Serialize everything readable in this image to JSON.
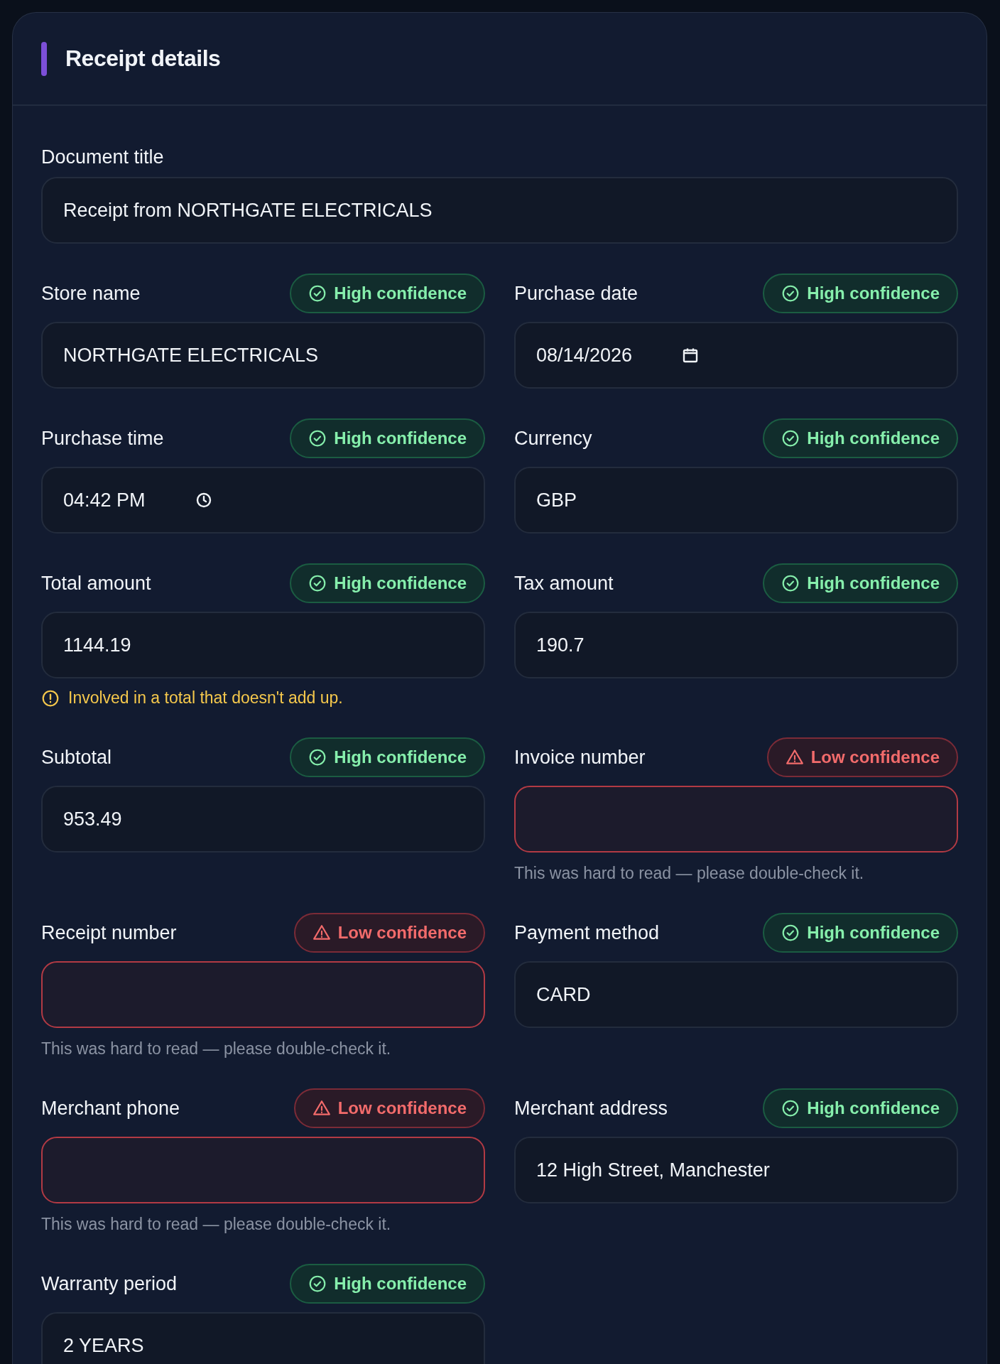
{
  "card": {
    "title": "Receipt details"
  },
  "document_title": {
    "label": "Document title",
    "value": "Receipt from NORTHGATE ELECTRICALS"
  },
  "fields": [
    {
      "label": "Store name",
      "kind": "text",
      "value": "NORTHGATE ELECTRICALS",
      "low_confidence": false,
      "badge": "High confidence"
    },
    {
      "label": "Purchase date",
      "kind": "date",
      "value": "08/14/2026",
      "low_confidence": false,
      "badge": "High confidence"
    },
    {
      "label": "Purchase time",
      "kind": "time",
      "value": "04:42 PM",
      "low_confidence": false,
      "badge": "High confidence"
    },
    {
      "label": "Currency",
      "kind": "text",
      "value": "GBP",
      "low_confidence": false,
      "badge": "High confidence"
    },
    {
      "label": "Total amount",
      "kind": "text",
      "value": "1144.19",
      "low_confidence": false,
      "badge": "High confidence",
      "warning": "Involved in a total that doesn't add up."
    },
    {
      "label": "Tax amount",
      "kind": "text",
      "value": "190.7",
      "low_confidence": false,
      "badge": "High confidence"
    },
    {
      "label": "Subtotal",
      "kind": "text",
      "value": "953.49",
      "low_confidence": false,
      "badge": "High confidence"
    },
    {
      "label": "Invoice number",
      "kind": "text",
      "low_confidence": true,
      "badge": "Low confidence",
      "hint": "This was hard to read — please double-check it."
    },
    {
      "label": "Receipt number",
      "kind": "text",
      "low_confidence": true,
      "badge": "Low confidence",
      "hint": "This was hard to read — please double-check it."
    },
    {
      "label": "Payment method",
      "kind": "text",
      "value": "CARD",
      "low_confidence": false,
      "badge": "High confidence"
    },
    {
      "label": "Merchant phone",
      "kind": "text",
      "low_confidence": true,
      "badge": "Low confidence",
      "hint": "This was hard to read — please double-check it."
    },
    {
      "label": "Merchant address",
      "kind": "text",
      "value": "12 High Street, Manchester",
      "low_confidence": false,
      "badge": "High confidence"
    },
    {
      "label": "Warranty period",
      "kind": "text",
      "value": "2 YEARS",
      "low_confidence": false,
      "badge": "High confidence"
    }
  ]
}
